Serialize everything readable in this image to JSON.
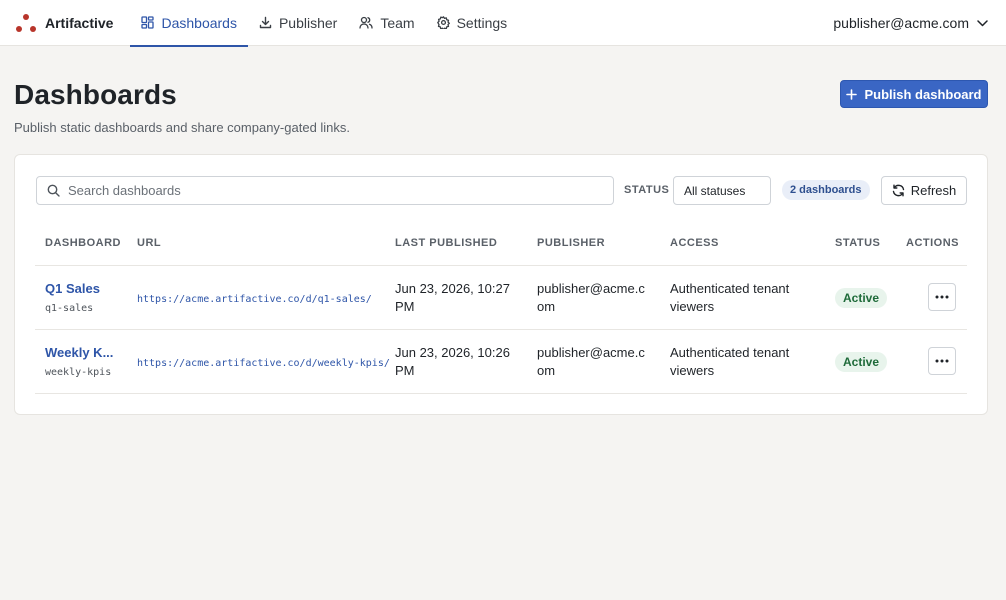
{
  "app": {
    "brand": "Artifactive",
    "user_email": "publisher@acme.com"
  },
  "nav": {
    "tabs": [
      {
        "label": "Dashboards",
        "icon": "dashboard-icon",
        "active": true
      },
      {
        "label": "Publisher",
        "icon": "download-icon",
        "active": false
      },
      {
        "label": "Team",
        "icon": "users-icon",
        "active": false
      },
      {
        "label": "Settings",
        "icon": "gear-icon",
        "active": false
      }
    ]
  },
  "header": {
    "title": "Dashboards",
    "subtitle": "Publish static dashboards and share company-gated links.",
    "publish_label": "Publish dashboard"
  },
  "filters": {
    "search_placeholder": "Search dashboards",
    "search_value": "",
    "status_label": "STATUS",
    "status_selected": "All statuses",
    "count": "2 dashboards",
    "refresh_label": "Refresh"
  },
  "table": {
    "columns": [
      "DASHBOARD",
      "URL",
      "LAST PUBLISHED",
      "PUBLISHER",
      "ACCESS",
      "STATUS",
      "ACTIONS"
    ],
    "rows": [
      {
        "name": "Q1 Sales",
        "slug": "q1-sales",
        "url": "https://acme.artifactive.co/d/q1-sales/",
        "last_published": "Jun 23, 2026, 10:27 PM",
        "publisher": "publisher@acme.com",
        "access": "Authenticated tenant viewers",
        "status": "Active"
      },
      {
        "name": "Weekly K...",
        "slug": "weekly-kpis",
        "url": "https://acme.artifactive.co/d/weekly-kpis/",
        "last_published": "Jun 23, 2026, 10:26 PM",
        "publisher": "publisher@acme.com",
        "access": "Authenticated tenant viewers",
        "status": "Active"
      }
    ]
  },
  "colors": {
    "accent": "#3a66c4",
    "link": "#2e55a8",
    "brand_dots": "#b8352b",
    "active_badge_bg": "#e8f4ec",
    "active_badge_text": "#1f6b3a",
    "page_bg": "#f5f4f2"
  }
}
